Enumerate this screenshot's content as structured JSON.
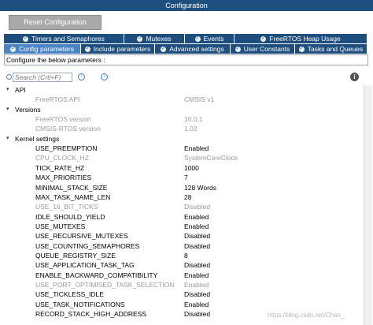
{
  "window": {
    "title": "Configuration"
  },
  "toolbar": {
    "reset_label": "Reset Configuration"
  },
  "tabs_row1": [
    {
      "label": "Timers and Semaphores",
      "checked": true,
      "active": false
    },
    {
      "label": "Mutexes",
      "checked": true,
      "active": false
    },
    {
      "label": "Events",
      "checked": true,
      "active": false
    },
    {
      "label": "FreeRTOS Heap Usage",
      "checked": true,
      "active": false
    }
  ],
  "tabs_row2": [
    {
      "label": "Config parameters",
      "checked": true,
      "active": true
    },
    {
      "label": "Include parameters",
      "checked": true,
      "active": false
    },
    {
      "label": "Advanced settings",
      "checked": true,
      "active": false
    },
    {
      "label": "User Constants",
      "checked": true,
      "active": false
    },
    {
      "label": "Tasks and Queues",
      "checked": true,
      "active": false
    }
  ],
  "instructions": "Configure the below parameters :",
  "search": {
    "placeholder": "Search (Crtl+F)"
  },
  "groups": [
    {
      "label": "API",
      "params": [
        {
          "name": "FreeRTOS API",
          "value": "CMSIS v1",
          "disabled": true
        }
      ]
    },
    {
      "label": "Versions",
      "params": [
        {
          "name": "FreeRTOS version",
          "value": "10.0.1",
          "disabled": true
        },
        {
          "name": "CMSIS-RTOS version",
          "value": "1.02",
          "disabled": true
        }
      ]
    },
    {
      "label": "Kernel settings",
      "params": [
        {
          "name": "USE_PREEMPTION",
          "value": "Enabled",
          "disabled": false
        },
        {
          "name": "CPU_CLOCK_HZ",
          "value": "SystemCoreClock",
          "disabled": true
        },
        {
          "name": "TICK_RATE_HZ",
          "value": "1000",
          "disabled": false
        },
        {
          "name": "MAX_PRIORITIES",
          "value": "7",
          "disabled": false
        },
        {
          "name": "MINIMAL_STACK_SIZE",
          "value": "128 Words",
          "disabled": false
        },
        {
          "name": "MAX_TASK_NAME_LEN",
          "value": "28",
          "disabled": false
        },
        {
          "name": "USE_16_BIT_TICKS",
          "value": "Disabled",
          "disabled": true
        },
        {
          "name": "IDLE_SHOULD_YIELD",
          "value": "Enabled",
          "disabled": false
        },
        {
          "name": "USE_MUTEXES",
          "value": "Enabled",
          "disabled": false
        },
        {
          "name": "USE_RECURSIVE_MUTEXES",
          "value": "Disabled",
          "disabled": false
        },
        {
          "name": "USE_COUNTING_SEMAPHORES",
          "value": "Disabled",
          "disabled": false
        },
        {
          "name": "QUEUE_REGISTRY_SIZE",
          "value": "8",
          "disabled": false
        },
        {
          "name": "USE_APPLICATION_TASK_TAG",
          "value": "Disabled",
          "disabled": false
        },
        {
          "name": "ENABLE_BACKWARD_COMPATIBILITY",
          "value": "Enabled",
          "disabled": false
        },
        {
          "name": "USE_PORT_OPTIMISED_TASK_SELECTION",
          "value": "Enabled",
          "disabled": true
        },
        {
          "name": "USE_TICKLESS_IDLE",
          "value": "Disabled",
          "disabled": false
        },
        {
          "name": "USE_TASK_NOTIFICATIONS",
          "value": "Enabled",
          "disabled": false
        },
        {
          "name": "RECORD_STACK_HIGH_ADDRESS",
          "value": "Disabled",
          "disabled": false
        }
      ]
    }
  ],
  "watermark": "https://blog.csdn.net/Chan_"
}
